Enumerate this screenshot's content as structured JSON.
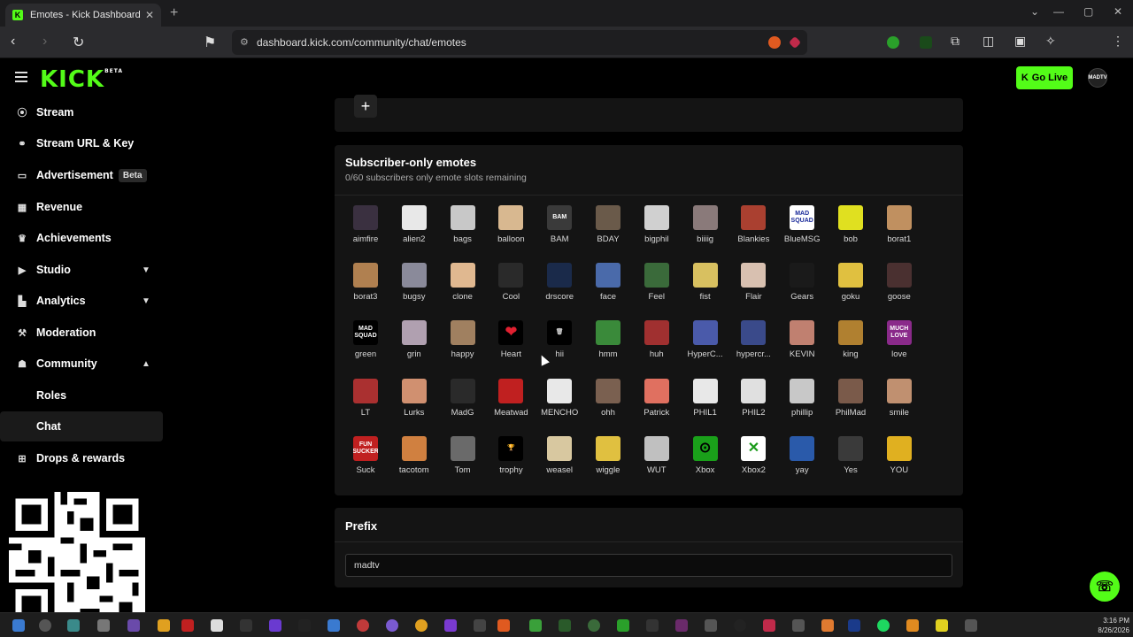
{
  "browser": {
    "tab_title": "Emotes - Kick Dashboard",
    "url": "dashboard.kick.com/community/chat/emotes",
    "new_tab": "+",
    "close": "✕"
  },
  "header": {
    "logo": "KICK",
    "logo_tag": "BETA",
    "go_live": "Go Live",
    "avatar_text": "MADTV"
  },
  "sidebar": {
    "items": [
      {
        "label": "Stream",
        "icon": "broadcast-icon"
      },
      {
        "label": "Stream URL & Key",
        "icon": "link-icon"
      },
      {
        "label": "Advertisement",
        "icon": "ad-icon",
        "badge": "Beta"
      },
      {
        "label": "Revenue",
        "icon": "calendar-icon"
      },
      {
        "label": "Achievements",
        "icon": "trophy-icon"
      },
      {
        "label": "Studio",
        "icon": "camera-icon"
      },
      {
        "label": "Analytics",
        "icon": "chart-icon"
      },
      {
        "label": "Moderation",
        "icon": "hammer-icon"
      },
      {
        "label": "Community",
        "icon": "people-icon"
      },
      {
        "label": "Roles"
      },
      {
        "label": "Chat"
      },
      {
        "label": "Drops & rewards",
        "icon": "gift-icon"
      }
    ]
  },
  "main": {
    "add_label": "+",
    "subscriber_title": "Subscriber-only emotes",
    "subscriber_subtitle": "0/60 subscribers only emote slots remaining",
    "prefix_title": "Prefix",
    "prefix_value": "madtv"
  },
  "emotes": [
    {
      "name": "aimfire",
      "color": "#3a3040"
    },
    {
      "name": "alien2",
      "color": "#e8e8e8"
    },
    {
      "name": "bags",
      "color": "#c8c8c8"
    },
    {
      "name": "balloon",
      "color": "#d8b890"
    },
    {
      "name": "BAM",
      "color": "#3a3a3a",
      "text": "BAM"
    },
    {
      "name": "BDAY",
      "color": "#6a5a4a"
    },
    {
      "name": "bigphil",
      "color": "#d0d0d0"
    },
    {
      "name": "biiiig",
      "color": "#8a7a7a"
    },
    {
      "name": "Blankies",
      "color": "#aa4030"
    },
    {
      "name": "BlueMSG",
      "color": "#ffffff",
      "text": "MAD SQUAD",
      "fg": "#1a2a9a"
    },
    {
      "name": "bob",
      "color": "#e0e020"
    },
    {
      "name": "borat1",
      "color": "#c09060"
    },
    {
      "name": "borat3",
      "color": "#b08050"
    },
    {
      "name": "bugsy",
      "color": "#8a8a9a"
    },
    {
      "name": "clone",
      "color": "#e0b890"
    },
    {
      "name": "Cool",
      "color": "#2a2a2a"
    },
    {
      "name": "drscore",
      "color": "#1a2a4a"
    },
    {
      "name": "face",
      "color": "#4a6aaa"
    },
    {
      "name": "Feel",
      "color": "#3a6a3a"
    },
    {
      "name": "fist",
      "color": "#d8c060"
    },
    {
      "name": "Flair",
      "color": "#d8c0b0"
    },
    {
      "name": "Gears",
      "color": "#1a1a1a"
    },
    {
      "name": "goku",
      "color": "#e0c040"
    },
    {
      "name": "goose",
      "color": "#4a3030"
    },
    {
      "name": "green",
      "color": "#000000",
      "text": "MAD SQUAD",
      "fg": "#ffffff"
    },
    {
      "name": "grin",
      "color": "#b0a0b0"
    },
    {
      "name": "happy",
      "color": "#a08060"
    },
    {
      "name": "Heart",
      "color": "#000000",
      "text": "❤",
      "fg": "#e02030"
    },
    {
      "name": "hii",
      "color": "#000000",
      "text": "🗑",
      "fg": "#cccccc"
    },
    {
      "name": "hmm",
      "color": "#3a8a3a"
    },
    {
      "name": "huh",
      "color": "#a03030"
    },
    {
      "name": "HyperC...",
      "color": "#4a5aaa"
    },
    {
      "name": "hypercr...",
      "color": "#3a4a8a"
    },
    {
      "name": "KEVIN",
      "color": "#c08070"
    },
    {
      "name": "king",
      "color": "#b08030"
    },
    {
      "name": "love",
      "color": "#8a2a8a",
      "text": "MUCH LOVE",
      "fg": "#ffffff"
    },
    {
      "name": "LT",
      "color": "#aa3030"
    },
    {
      "name": "Lurks",
      "color": "#d09070"
    },
    {
      "name": "MadG",
      "color": "#2a2a2a"
    },
    {
      "name": "Meatwad",
      "color": "#c02020"
    },
    {
      "name": "MENCHO",
      "color": "#e8e8e8"
    },
    {
      "name": "ohh",
      "color": "#7a6050"
    },
    {
      "name": "Patrick",
      "color": "#e07060"
    },
    {
      "name": "PHIL1",
      "color": "#e8e8e8"
    },
    {
      "name": "PHIL2",
      "color": "#e0e0e0"
    },
    {
      "name": "phillip",
      "color": "#c8c8c8"
    },
    {
      "name": "PhilMad",
      "color": "#7a5a4a"
    },
    {
      "name": "smile",
      "color": "#c09070"
    },
    {
      "name": "Suck",
      "color": "#c02020",
      "text": "FUN SUCKER",
      "fg": "#ffffff"
    },
    {
      "name": "tacotom",
      "color": "#d08040"
    },
    {
      "name": "Tom",
      "color": "#6a6a6a"
    },
    {
      "name": "trophy",
      "color": "#000000",
      "text": "🏆",
      "fg": "#e0b020"
    },
    {
      "name": "weasel",
      "color": "#d8c8a0"
    },
    {
      "name": "wiggle",
      "color": "#e0c040"
    },
    {
      "name": "WUT",
      "color": "#c0c0c0"
    },
    {
      "name": "Xbox",
      "color": "#1aa01a",
      "text": "⊙",
      "fg": "#000000"
    },
    {
      "name": "Xbox2",
      "color": "#ffffff",
      "text": "✕",
      "fg": "#1a9a1a"
    },
    {
      "name": "yay",
      "color": "#2a5aaa"
    },
    {
      "name": "Yes",
      "color": "#3a3a3a"
    },
    {
      "name": "YOU",
      "color": "#e0b020"
    }
  ],
  "taskbar": {
    "time": "3:16 PM",
    "date": "8/26/2026"
  }
}
